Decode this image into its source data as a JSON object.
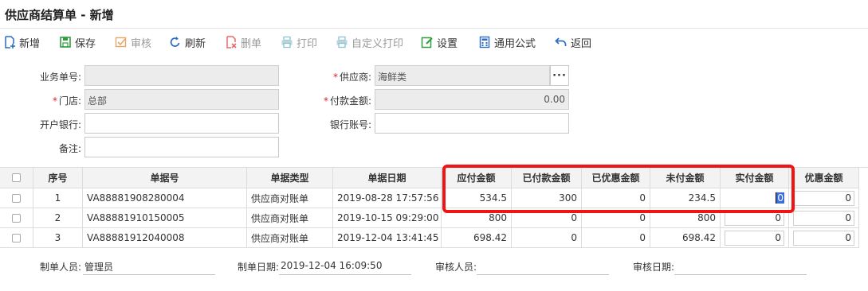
{
  "window": {
    "title": "供应商结算单 - 新增"
  },
  "toolbar": {
    "add": "新增",
    "save": "保存",
    "audit": "审核",
    "refresh": "刷新",
    "delete": "删单",
    "print": "打印",
    "custom_print": "自定义打印",
    "settings": "设置",
    "formula": "通用公式",
    "back": "返回"
  },
  "form": {
    "bizno_label": "业务单号:",
    "bizno_value": "",
    "supplier_label": "供应商:",
    "supplier_value": "海鲜类",
    "store_label": "门店:",
    "store_value": "总部",
    "payamt_label": "付款金额:",
    "payamt_value": "0.00",
    "bank_label": "开户银行:",
    "bank_value": "",
    "account_label": "银行账号:",
    "account_value": "",
    "remark_label": "备注:",
    "remark_value": ""
  },
  "grid": {
    "headers": [
      "序号",
      "单据号",
      "单据类型",
      "单据日期",
      "应付金额",
      "已付款金额",
      "已优惠金额",
      "未付金额",
      "实付金额",
      "优惠金额"
    ],
    "rows": [
      {
        "seq": "1",
        "docno": "VA88881908280004",
        "type": "供应商对账单",
        "date": "2019-08-28 17:57:56",
        "payable": "534.5",
        "paid": "300",
        "discounted": "0",
        "unpaid": "234.5",
        "actual": "0",
        "discount": "0"
      },
      {
        "seq": "2",
        "docno": "VA88881910150005",
        "type": "供应商对账单",
        "date": "2019-10-15 09:29:00",
        "payable": "800",
        "paid": "0",
        "discounted": "0",
        "unpaid": "800",
        "actual": "0",
        "discount": "0"
      },
      {
        "seq": "3",
        "docno": "VA88881912040008",
        "type": "供应商对账单",
        "date": "2019-12-04 13:41:45",
        "payable": "698.42",
        "paid": "0",
        "discounted": "0",
        "unpaid": "698.42",
        "actual": "0",
        "discount": "0"
      }
    ]
  },
  "footer": {
    "creator_label": "制单人员:",
    "creator_value": "管理员",
    "created_label": "制单日期:",
    "created_value": "2019-12-04 16:09:50",
    "auditor_label": "审核人员:",
    "auditor_value": "",
    "audited_label": "审核日期:",
    "audited_value": ""
  },
  "colors": {
    "highlight": "#f01414",
    "required": "#e02020",
    "header_bg": "#f3f3f3",
    "readonly_bg": "#ececec"
  }
}
